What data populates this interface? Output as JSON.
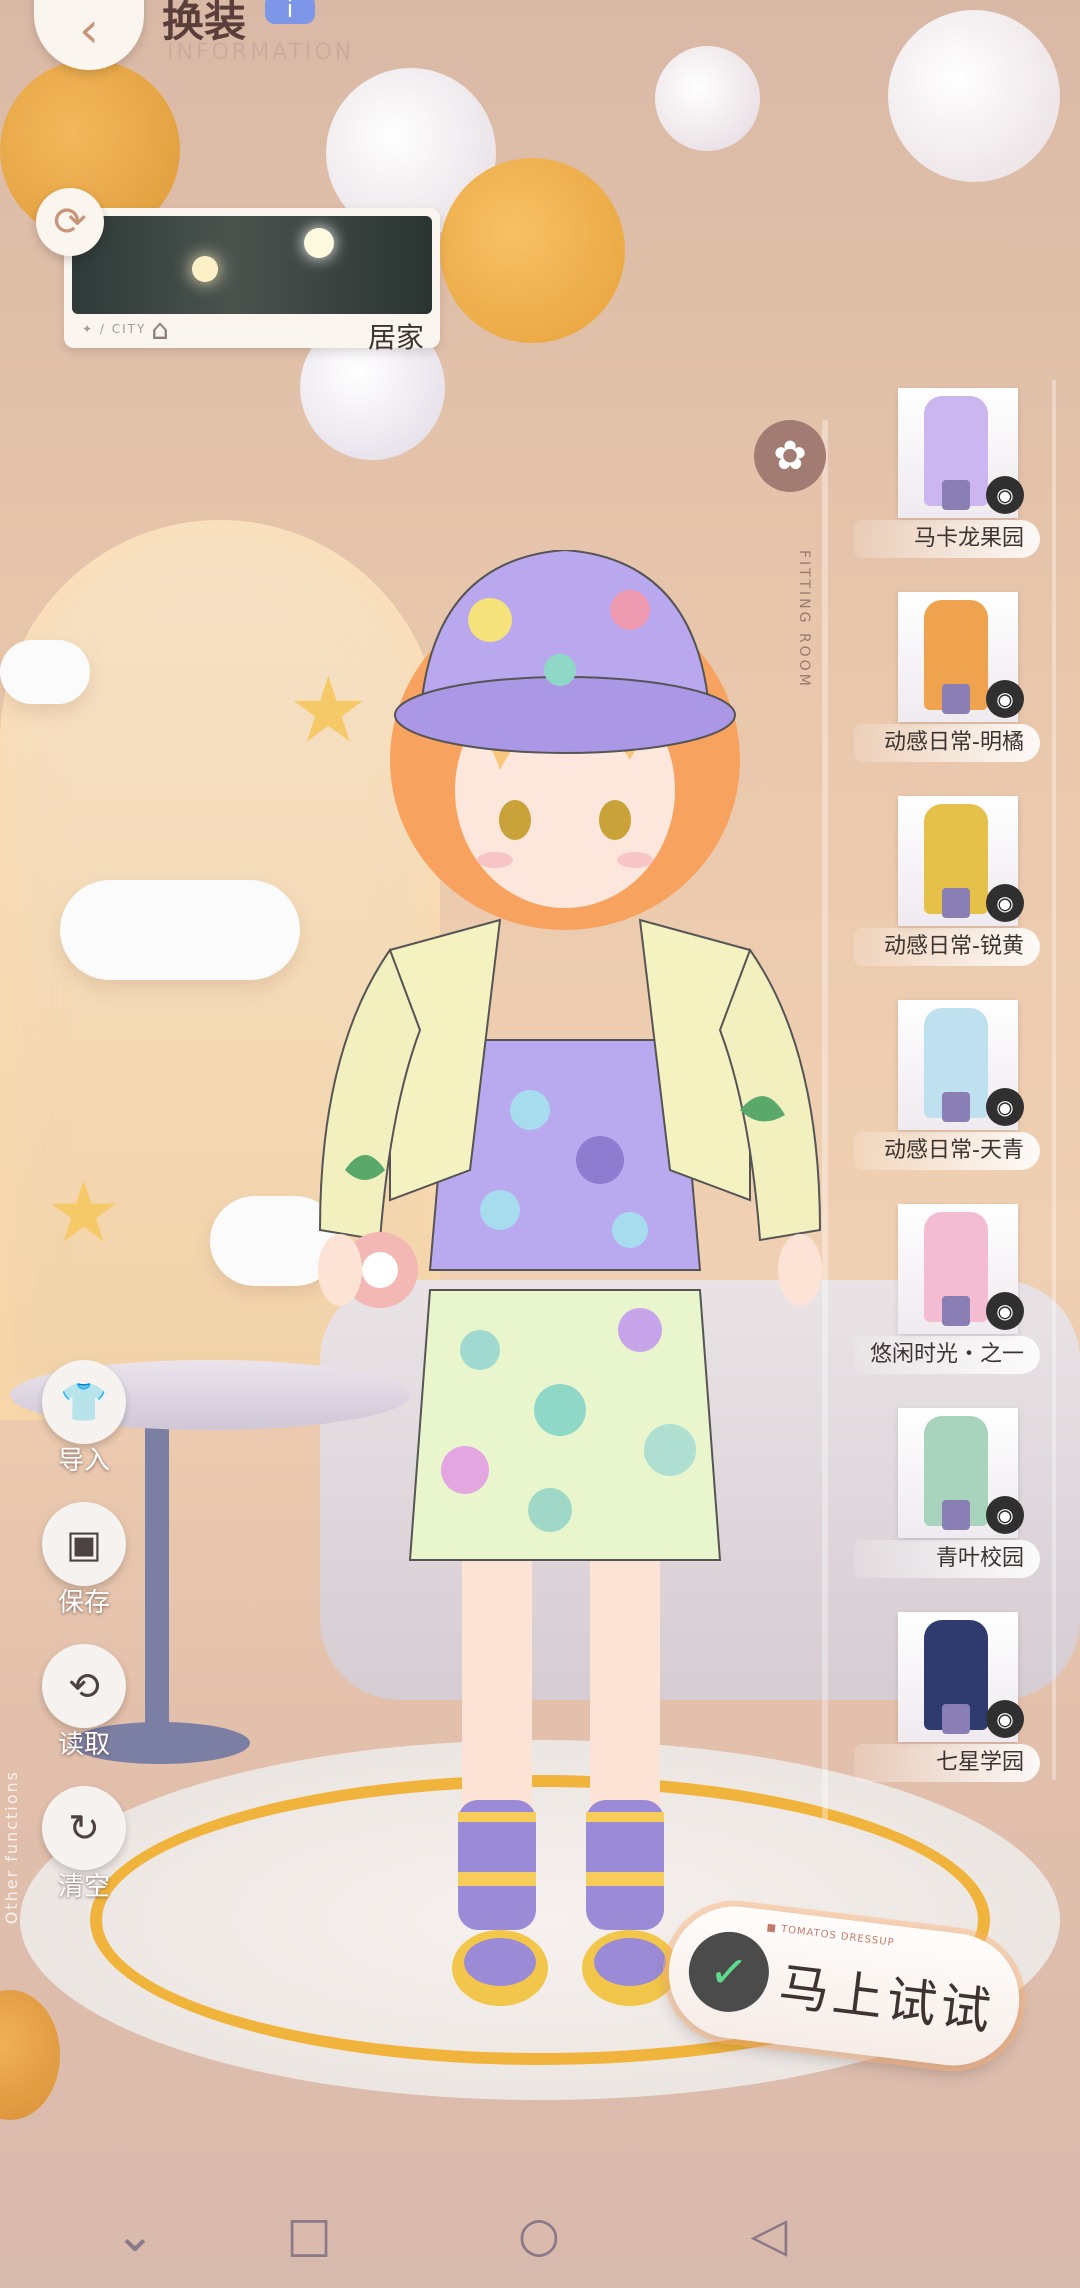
{
  "header": {
    "title": "换装",
    "badge": "i",
    "subtitle": "INFORMATION"
  },
  "scene": {
    "label": "居家",
    "tag": "✦ / CITY"
  },
  "outfit_panel": {
    "vertical_text": "FITTING ROOM",
    "items": [
      {
        "name": "马卡龙果园",
        "color": "#cbb6f0"
      },
      {
        "name": "动感日常-明橘",
        "color": "#f0a34e"
      },
      {
        "name": "动感日常-锐黄",
        "color": "#e6c14a"
      },
      {
        "name": "动感日常-天青",
        "color": "#bfe1ef"
      },
      {
        "name": "悠闲时光・之一",
        "color": "#f4bcd0"
      },
      {
        "name": "青叶校园",
        "color": "#a8d4be"
      },
      {
        "name": "七星学园",
        "color": "#2f3a6e"
      }
    ]
  },
  "left_actions": [
    {
      "label": "导入",
      "icon": "import-icon"
    },
    {
      "label": "保存",
      "icon": "save-icon"
    },
    {
      "label": "读取",
      "icon": "load-icon"
    },
    {
      "label": "清空",
      "icon": "clear-icon"
    }
  ],
  "other_functions": "Other functions",
  "try_button": {
    "label": "马上试试",
    "tag": "■ TOMATOS DRESSUP"
  },
  "colors": {
    "accent": "#f0b43c",
    "check": "#5fd98c",
    "card": "#fbf5ef"
  }
}
